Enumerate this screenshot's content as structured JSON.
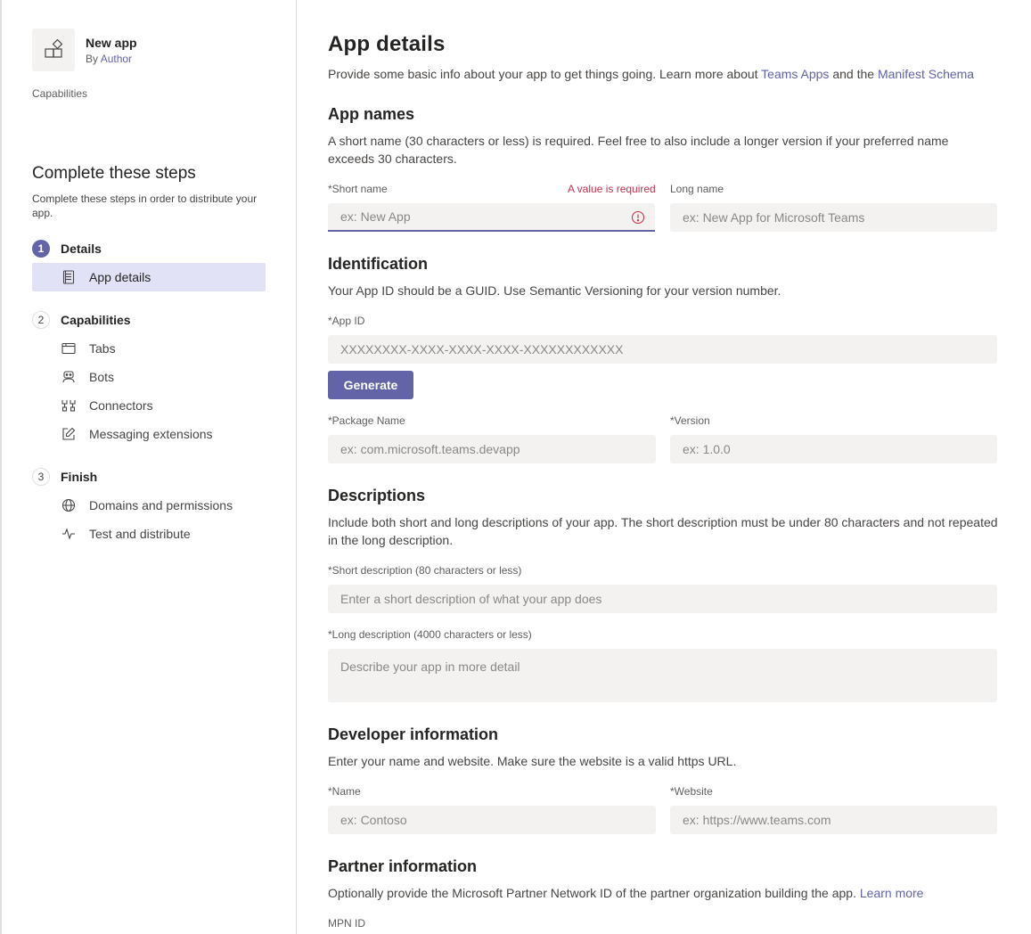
{
  "sidebar": {
    "app_name": "New app",
    "author_prefix": "By ",
    "author_link": "Author",
    "capabilities_label": "Capabilities",
    "steps_title": "Complete these steps",
    "steps_subtitle": "Complete these steps in order to distribute your app.",
    "sections": [
      {
        "number": "1",
        "label": "Details",
        "active": true
      },
      {
        "number": "2",
        "label": "Capabilities",
        "active": false
      },
      {
        "number": "3",
        "label": "Finish",
        "active": false
      }
    ],
    "items": [
      {
        "label": "App details",
        "icon": "document-icon",
        "selected": true
      },
      {
        "label": "Tabs",
        "icon": "tab-icon"
      },
      {
        "label": "Bots",
        "icon": "bot-icon"
      },
      {
        "label": "Connectors",
        "icon": "connector-icon"
      },
      {
        "label": "Messaging extensions",
        "icon": "edit-icon"
      },
      {
        "label": "Domains and permissions",
        "icon": "globe-icon"
      },
      {
        "label": "Test and distribute",
        "icon": "pulse-icon"
      }
    ]
  },
  "main": {
    "title": "App details",
    "intro_text": "Provide some basic info about your app to get things going. Learn more about ",
    "intro_link1": "Teams Apps",
    "intro_mid": " and the ",
    "intro_link2": "Manifest Schema",
    "app_names": {
      "heading": "App names",
      "description": "A short name (30 characters or less) is required. Feel free to also include a longer version if your preferred name exceeds 30 characters.",
      "short_name_label": "*Short name",
      "short_name_error": "A value is required",
      "short_name_placeholder": "ex: New App",
      "long_name_label": "Long name",
      "long_name_placeholder": "ex: New App for Microsoft Teams"
    },
    "identification": {
      "heading": "Identification",
      "description": "Your App ID should be a GUID. Use Semantic Versioning for your version number.",
      "app_id_label": "*App ID",
      "app_id_placeholder": "XXXXXXXX-XXXX-XXXX-XXXX-XXXXXXXXXXXX",
      "generate_label": "Generate",
      "package_label": "*Package Name",
      "package_placeholder": "ex: com.microsoft.teams.devapp",
      "version_label": "*Version",
      "version_placeholder": "ex: 1.0.0"
    },
    "descriptions": {
      "heading": "Descriptions",
      "description": "Include both short and long descriptions of your app. The short description must be under 80 characters and not repeated in the long description.",
      "short_label": "*Short description (80 characters or less)",
      "short_placeholder": "Enter a short description of what your app does",
      "long_label": "*Long description (4000 characters or less)",
      "long_placeholder": "Describe your app in more detail"
    },
    "developer": {
      "heading": "Developer information",
      "description": "Enter your name and website. Make sure the website is a valid https URL.",
      "name_label": "*Name",
      "name_placeholder": "ex: Contoso",
      "website_label": "*Website",
      "website_placeholder": "ex: https://www.teams.com"
    },
    "partner": {
      "heading": "Partner information",
      "description": "Optionally provide the Microsoft Partner Network ID of the partner organization building the app. ",
      "learn_more": "Learn more",
      "mpn_label": "MPN ID"
    }
  },
  "colors": {
    "accent": "#6264a7",
    "error": "#c4314b",
    "field_bg": "#f3f2f1",
    "selected_bg": "#e2e2f6"
  }
}
